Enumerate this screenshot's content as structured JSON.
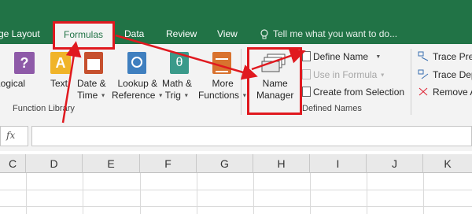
{
  "tabs": {
    "page_layout": "ge Layout",
    "formulas": "Formulas",
    "data": "Data",
    "review": "Review",
    "view": "View",
    "tell_me": "Tell me what you want to do..."
  },
  "function_library": {
    "logical": "Logical",
    "text": "Text",
    "date_time_1": "Date &",
    "date_time_2": "Time",
    "lookup_1": "Lookup &",
    "lookup_2": "Reference",
    "math_1": "Math &",
    "math_2": "Trig",
    "more_1": "More",
    "more_2": "Functions",
    "group_label": "Function Library"
  },
  "defined_names": {
    "name_manager_1": "Name",
    "name_manager_2": "Manager",
    "define_name": "Define Name",
    "use_in_formula": "Use in Formula",
    "create_from_selection": "Create from Selection",
    "group_label": "Defined Names"
  },
  "formula_auditing": {
    "trace_precedents": "Trace Prec",
    "trace_dependents": "Trace Dep",
    "remove_arrows": "Remove A"
  },
  "formula_bar": {
    "fx": "fx",
    "name_box": "",
    "content": ""
  },
  "columns": [
    "C",
    "D",
    "E",
    "F",
    "G",
    "H",
    "I",
    "J",
    "K"
  ],
  "colors": {
    "excel_green": "#217346",
    "annotation_red": "#e0191f"
  }
}
